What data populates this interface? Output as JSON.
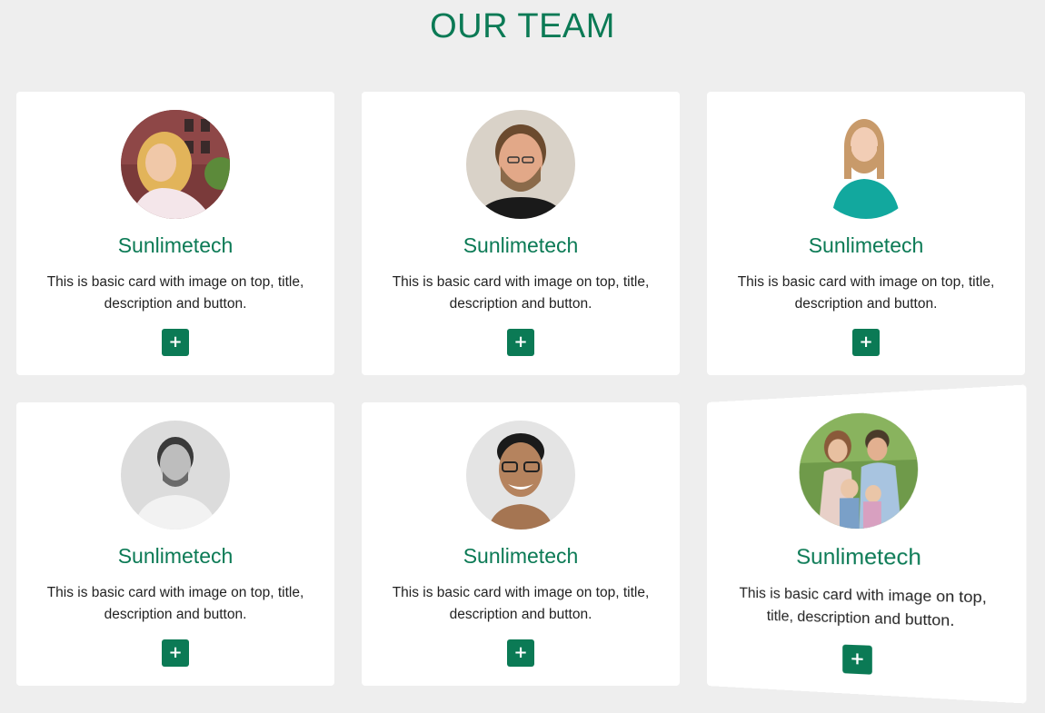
{
  "page": {
    "title": "OUR TEAM"
  },
  "colors": {
    "accent": "#0b7a55",
    "background": "#eeeeee",
    "card": "#ffffff"
  },
  "cards": [
    {
      "name": "Sunlimetech",
      "description": "This is basic card with image on top, title, description and button.",
      "button_icon": "plus-icon",
      "button_label": "+"
    },
    {
      "name": "Sunlimetech",
      "description": "This is basic card with image on top, title, description and button.",
      "button_icon": "plus-icon",
      "button_label": "+"
    },
    {
      "name": "Sunlimetech",
      "description": "This is basic card with image on top, title, description and button.",
      "button_icon": "plus-icon",
      "button_label": "+"
    },
    {
      "name": "Sunlimetech",
      "description": "This is basic card with image on top, title, description and button.",
      "button_icon": "plus-icon",
      "button_label": "+"
    },
    {
      "name": "Sunlimetech",
      "description": "This is basic card with image on top, title, description and button.",
      "button_icon": "plus-icon",
      "button_label": "+"
    },
    {
      "name": "Sunlimetech",
      "description": "This is basic card with image on top, title, description and button.",
      "button_icon": "plus-icon",
      "button_label": "+"
    }
  ]
}
